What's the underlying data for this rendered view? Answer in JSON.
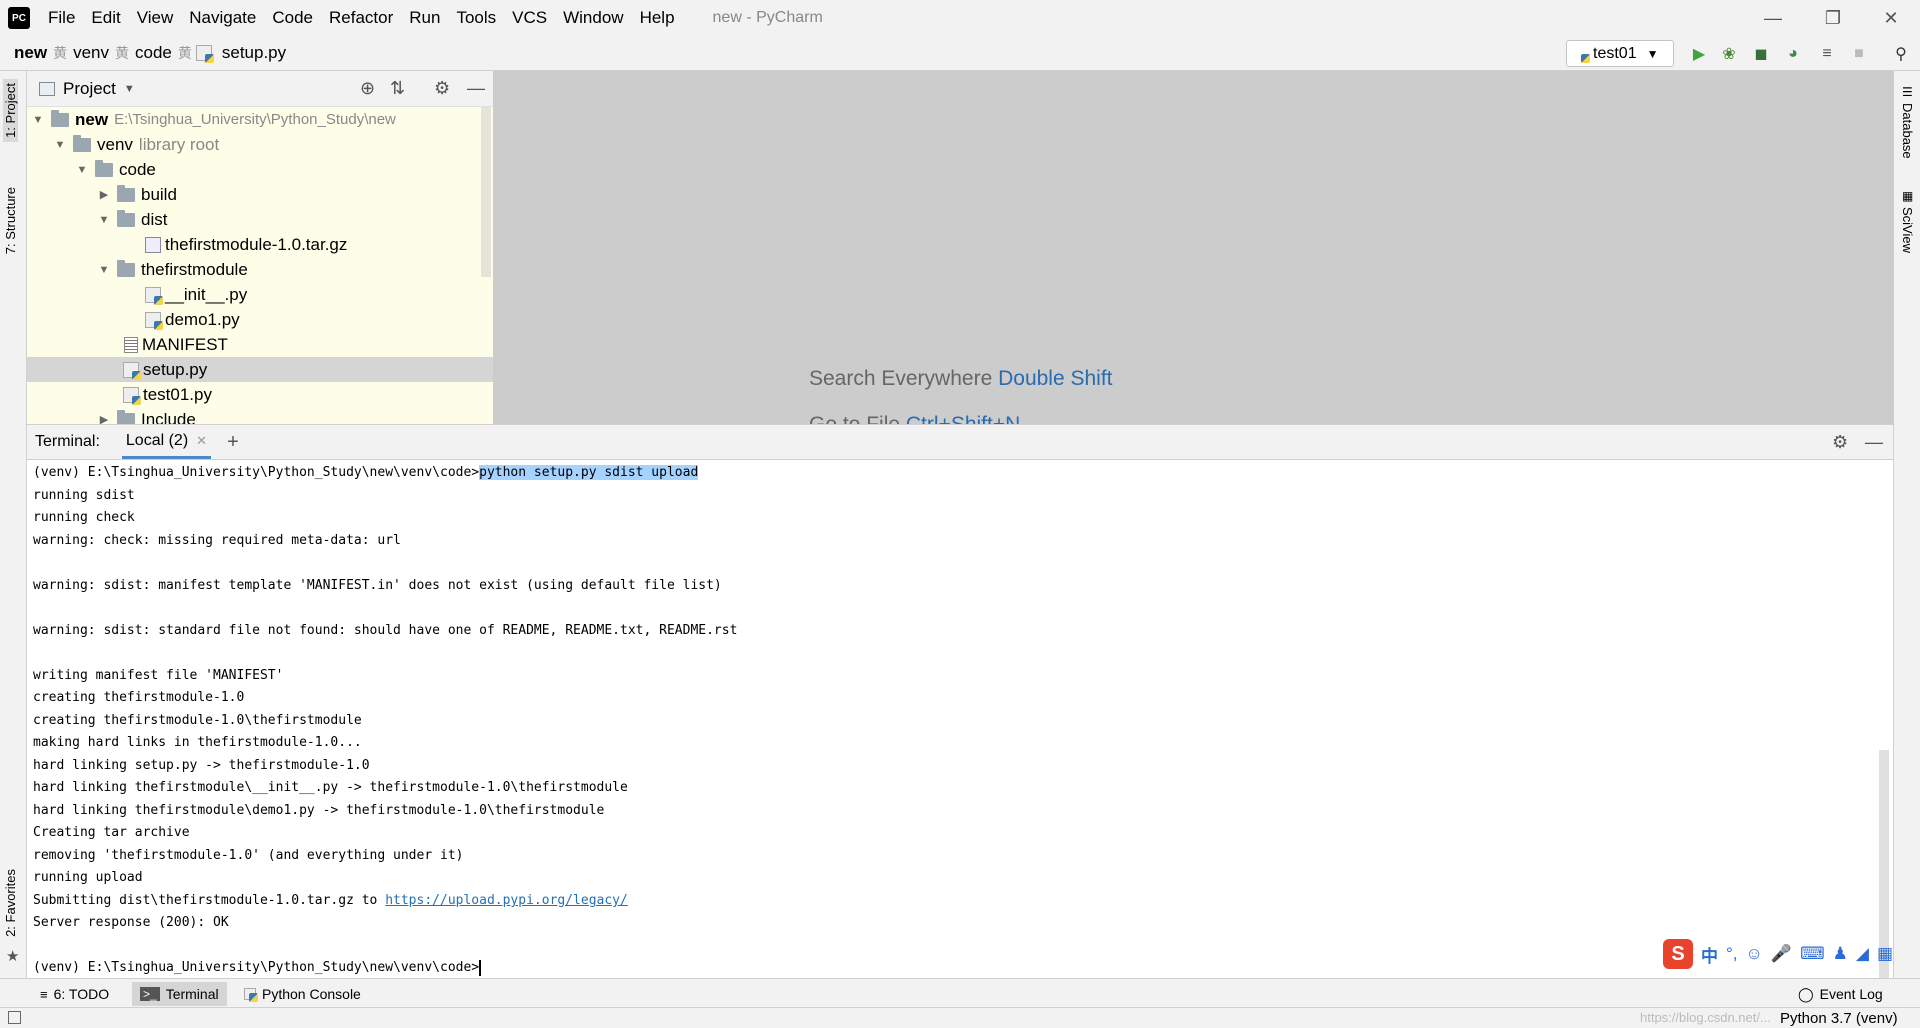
{
  "window": {
    "title": "new - PyCharm",
    "logo_text": "PC",
    "menu": [
      "File",
      "Edit",
      "View",
      "Navigate",
      "Code",
      "Refactor",
      "Run",
      "Tools",
      "VCS",
      "Window",
      "Help"
    ]
  },
  "breadcrumb": [
    "new",
    "venv",
    "code",
    "setup.py"
  ],
  "toolbar": {
    "run_config": "test01"
  },
  "left_stripe": {
    "project_tab": "1: Project",
    "structure_tab": "7: Structure",
    "favorites_tab": "2: Favorites"
  },
  "right_stripe": {
    "database_tab": "Database",
    "sciview_tab": "SciView"
  },
  "project_panel": {
    "title": "Project",
    "tree": [
      {
        "label": "new",
        "path": "E:\\Tsinghua_University\\Python_Study\\new"
      },
      {
        "label": "venv",
        "note": "library root"
      },
      {
        "label": "code"
      },
      {
        "label": "build"
      },
      {
        "label": "dist"
      },
      {
        "label": "thefirstmodule-1.0.tar.gz"
      },
      {
        "label": "thefirstmodule"
      },
      {
        "label": "__init__.py"
      },
      {
        "label": "demo1.py"
      },
      {
        "label": "MANIFEST"
      },
      {
        "label": "setup.py"
      },
      {
        "label": "test01.py"
      },
      {
        "label": "Include"
      }
    ]
  },
  "editor": {
    "search_hint": "Search Everywhere",
    "search_key": "Double Shift",
    "goto_hint": "Go to File",
    "goto_key": "Ctrl+Shift+N"
  },
  "terminal": {
    "label": "Terminal:",
    "tab": "Local (2)",
    "prompt": "(venv) E:\\Tsinghua_University\\Python_Study\\new\\venv\\code>",
    "command": "python setup.py sdist upload",
    "lines": [
      "running sdist",
      "running check",
      "warning: check: missing required meta-data: url",
      "",
      "warning: sdist: manifest template 'MANIFEST.in' does not exist (using default file list)",
      "",
      "warning: sdist: standard file not found: should have one of README, README.txt, README.rst",
      "",
      "writing manifest file 'MANIFEST'",
      "creating thefirstmodule-1.0",
      "creating thefirstmodule-1.0\\thefirstmodule",
      "making hard links in thefirstmodule-1.0...",
      "hard linking setup.py -> thefirstmodule-1.0",
      "hard linking thefirstmodule\\__init__.py -> thefirstmodule-1.0\\thefirstmodule",
      "hard linking thefirstmodule\\demo1.py -> thefirstmodule-1.0\\thefirstmodule",
      "Creating tar archive",
      "removing 'thefirstmodule-1.0' (and everything under it)",
      "running upload"
    ],
    "submit_prefix": "Submitting dist\\thefirstmodule-1.0.tar.gz to ",
    "submit_url": "https://upload.pypi.org/legacy/",
    "server_response": "Server response (200): OK",
    "final_prompt": "(venv) E:\\Tsinghua_University\\Python_Study\\new\\venv\\code>"
  },
  "bottom_tabs": {
    "todo": "6: TODO",
    "terminal": "Terminal",
    "python_console": "Python Console",
    "event_log": "Event Log"
  },
  "status": {
    "interpreter": "Python 3.7 (venv)",
    "watermark": "https://blog.csdn.net/..."
  },
  "ime": {
    "lang": "中"
  }
}
